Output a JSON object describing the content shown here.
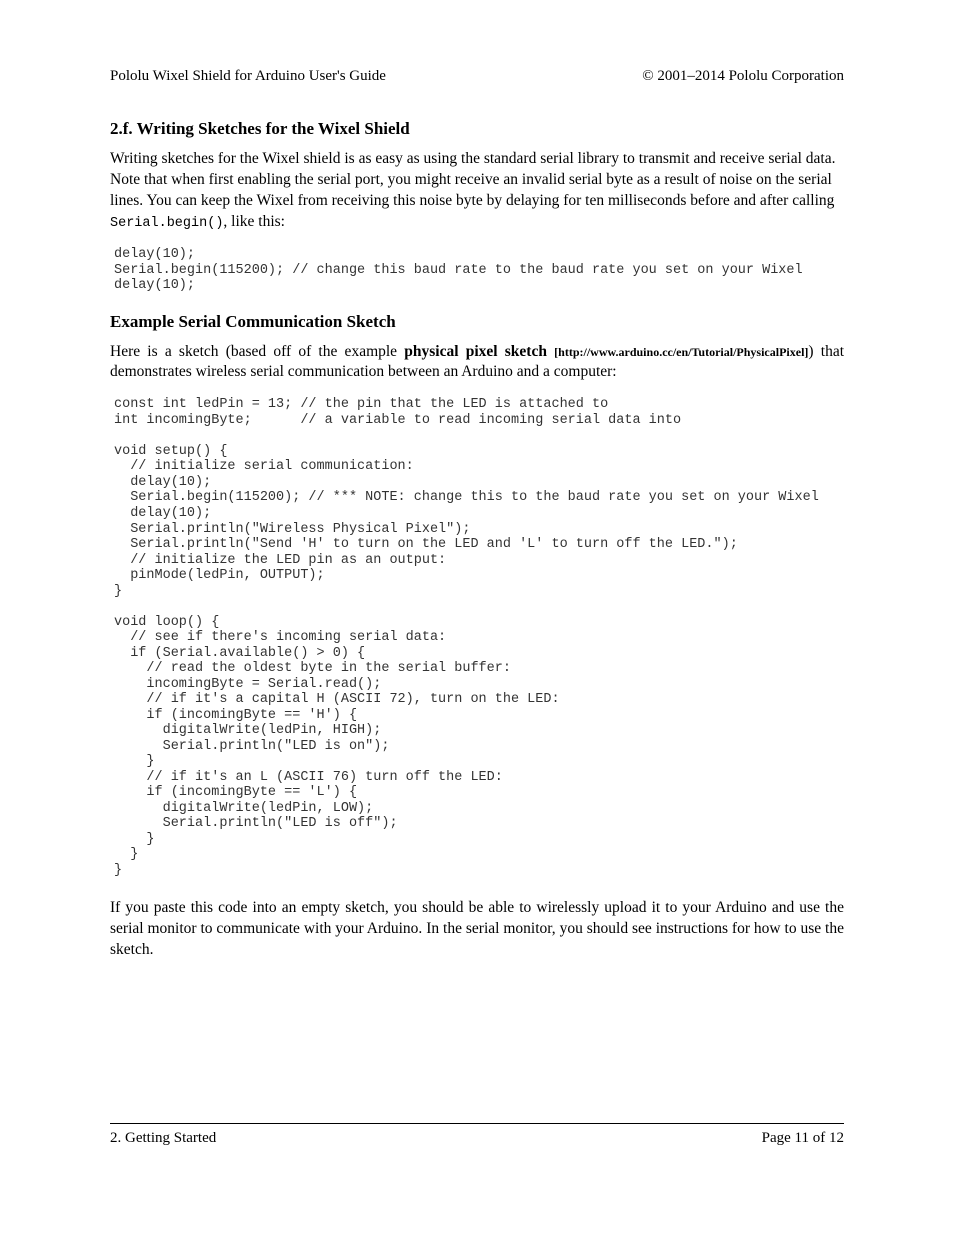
{
  "header": {
    "left": "Pololu Wixel Shield for Arduino User's Guide",
    "right": "© 2001–2014 Pololu Corporation"
  },
  "section": {
    "title": "2.f. Writing Sketches for the Wixel Shield",
    "intro_a": "Writing sketches for the Wixel shield is as easy as using the standard serial library to transmit and receive serial data. Note that when first enabling the serial port, you might receive an invalid serial byte as a result of noise on the serial lines. You can keep the Wixel from receiving this noise byte by delaying for ten milliseconds before and after calling ",
    "intro_code": "Serial.begin()",
    "intro_b": ", like this:",
    "code1": "delay(10);\nSerial.begin(115200); // change this baud rate to the baud rate you set on your Wixel\ndelay(10);",
    "sub_title": "Example Serial Communication Sketch",
    "p2_a": "Here is a sketch (based off of the example ",
    "p2_link_text": "physical pixel sketch ",
    "p2_link_url": "[http://www.arduino.cc/en/Tutorial/PhysicalPixel]",
    "p2_b": ") that demonstrates wireless serial communication between an Arduino and a computer:",
    "code2": "const int ledPin = 13; // the pin that the LED is attached to\nint incomingByte;      // a variable to read incoming serial data into\n\nvoid setup() {\n  // initialize serial communication:\n  delay(10);\n  Serial.begin(115200); // *** NOTE: change this to the baud rate you set on your Wixel\n  delay(10);\n  Serial.println(\"Wireless Physical Pixel\");\n  Serial.println(\"Send 'H' to turn on the LED and 'L' to turn off the LED.\");\n  // initialize the LED pin as an output:\n  pinMode(ledPin, OUTPUT);\n}\n\nvoid loop() {\n  // see if there's incoming serial data:\n  if (Serial.available() > 0) {\n    // read the oldest byte in the serial buffer:\n    incomingByte = Serial.read();\n    // if it's a capital H (ASCII 72), turn on the LED:\n    if (incomingByte == 'H') {\n      digitalWrite(ledPin, HIGH);\n      Serial.println(\"LED is on\");\n    }\n    // if it's an L (ASCII 76) turn off the LED:\n    if (incomingByte == 'L') {\n      digitalWrite(ledPin, LOW);\n      Serial.println(\"LED is off\");\n    }\n  }\n}",
    "p3": "If you paste this code into an empty sketch, you should be able to wirelessly upload it to your Arduino and use the serial monitor to communicate with your Arduino. In the serial monitor, you should see instructions for how to use the sketch."
  },
  "footer": {
    "left": "2. Getting Started",
    "right": "Page 11 of 12"
  }
}
